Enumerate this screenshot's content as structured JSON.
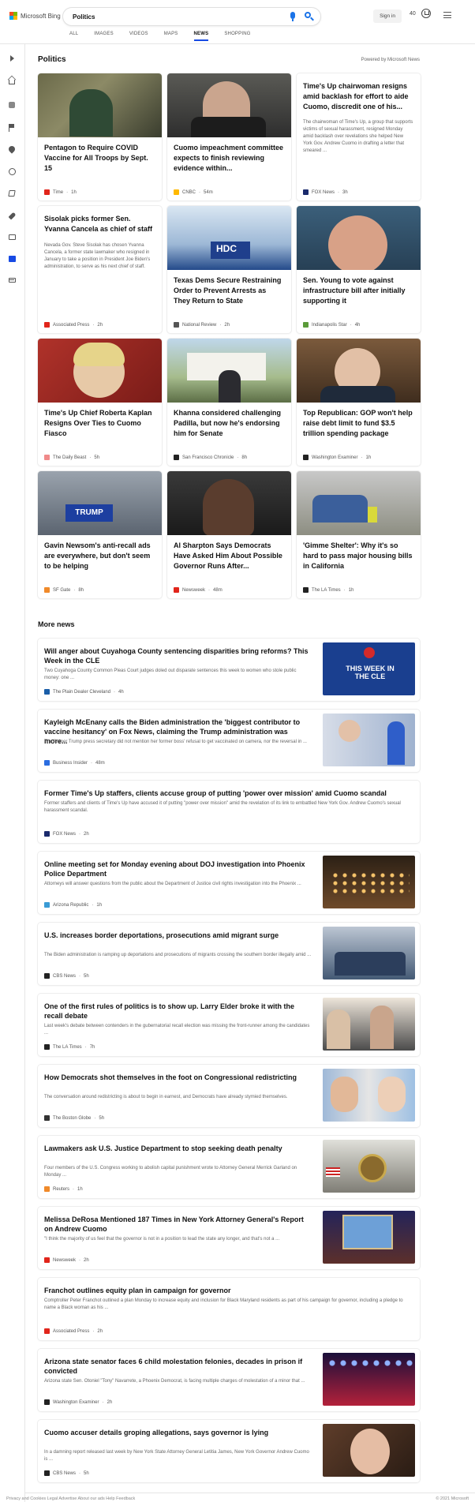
{
  "header": {
    "logo_text": "Microsoft Bing",
    "search_value": "Politics",
    "signin_label": "Sign in",
    "rewards_count": "40",
    "tabs": [
      {
        "label": "ALL",
        "active": false
      },
      {
        "label": "IMAGES",
        "active": false
      },
      {
        "label": "VIDEOS",
        "active": false
      },
      {
        "label": "MAPS",
        "active": false
      },
      {
        "label": "NEWS",
        "active": true
      },
      {
        "label": "SHOPPING",
        "active": false
      }
    ]
  },
  "main": {
    "title": "Politics",
    "powered_by": "Powered by Microsoft News",
    "top_stories": [
      {
        "title": "Pentagon to Require COVID Vaccine for All Troops by Sept. 15",
        "snippet": "",
        "source": "Time",
        "age": "1h",
        "logo_color": "#e1251b",
        "art": "a1"
      },
      {
        "title": "Cuomo impeachment committee expects to finish reviewing evidence within...",
        "snippet": "",
        "source": "CNBC",
        "age": "54m",
        "logo_color": "#ffb900",
        "art": "a2"
      },
      {
        "title": "Time's Up chairwoman resigns amid backlash for effort to aide Cuomo, discredit one of his...",
        "snippet": "The chairwoman of Time's Up, a group that supports victims of sexual harassment, resigned Monday amid backlash over revelations she helped New York Gov. Andrew Cuomo in drafting a letter that smeared ...",
        "source": "FOX News",
        "age": "3h",
        "logo_color": "#1a2a6c",
        "art": ""
      },
      {
        "title": "Sisolak picks former Sen. Yvanna Cancela as chief of staff",
        "snippet": "Nevada Gov. Steve Sisolak has chosen Yvanna Cancela, a former state lawmaker who resigned in January to take a position in President Joe Biden's administration, to serve as his next chief of staff.",
        "source": "Associated Press",
        "age": "2h",
        "logo_color": "#e1251b",
        "art": ""
      },
      {
        "title": "Texas Dems Secure Restraining Order to Prevent Arrests as They Return to State",
        "snippet": "",
        "source": "National Review",
        "age": "2h",
        "logo_color": "#555555",
        "art": "a3"
      },
      {
        "title": "Sen. Young to vote against infrastructure bill after initially supporting it",
        "snippet": "",
        "source": "Indianapolis Star",
        "age": "4h",
        "logo_color": "#5b9b3a",
        "art": "a4"
      },
      {
        "title": "Time's Up Chief Roberta Kaplan Resigns Over Ties to Cuomo Fiasco",
        "snippet": "",
        "source": "The Daily Beast",
        "age": "5h",
        "logo_color": "#f08a8a",
        "art": "a5"
      },
      {
        "title": "Khanna considered challenging Padilla, but now he's endorsing him for Senate",
        "snippet": "",
        "source": "San Francisco Chronicle",
        "age": "8h",
        "logo_color": "#222222",
        "art": "a6"
      },
      {
        "title": "Top Republican: GOP won't help raise debt limit to fund $3.5 trillion spending package",
        "snippet": "",
        "source": "Washington Examiner",
        "age": "1h",
        "logo_color": "#222222",
        "art": "a7"
      },
      {
        "title": "Gavin Newsom's anti-recall ads are everywhere, but don't seem to be helping",
        "snippet": "",
        "source": "SF Gate",
        "age": "8h",
        "logo_color": "#f08a2a",
        "art": "a8"
      },
      {
        "title": "Al Sharpton Says Democrats Have Asked Him About Possible Governor Runs After...",
        "snippet": "",
        "source": "Newsweek",
        "age": "48m",
        "logo_color": "#e1251b",
        "art": "a9"
      },
      {
        "title": "'Gimme Shelter': Why it's so hard to pass major housing bills in California",
        "snippet": "",
        "source": "The LA Times",
        "age": "1h",
        "logo_color": "#222222",
        "art": "a10"
      }
    ],
    "more_title": "More news",
    "more_news": [
      {
        "title": "Will anger about Cuyahoga County sentencing disparities bring reforms? This Week in the CLE",
        "snippet": "Two Cuyahoga County Common Pleas Court judges doled out disparate sentences this week to women who stole public money: one ...",
        "source": "The Plain Dealer Cleveland",
        "age": "4h",
        "logo_color": "#1a5ea8",
        "art": "r1"
      },
      {
        "title": "Kayleigh McEnany calls the Biden administration the 'biggest contributor to vaccine hesitancy' on Fox News, claiming the Trump administration was more...",
        "snippet": "The former Trump press secretary did not mention her former boss' refusal to get vaccinated on camera, nor the reversal in ...",
        "source": "Business Insider",
        "age": "48m",
        "logo_color": "#2b6de0",
        "art": "r2"
      },
      {
        "title": "Former Time's Up staffers, clients accuse group of putting 'power over mission' amid Cuomo scandal",
        "snippet": "Former staffers and clients of Time's Up have accused it of putting \"power over mission\" amid the revelation of its link to embattled New York Gov. Andrew Cuomo's sexual harassment scandal.",
        "source": "FOX News",
        "age": "2h",
        "logo_color": "#1a2a6c",
        "art": ""
      },
      {
        "title": "Online meeting set for Monday evening about DOJ investigation into Phoenix Police Department",
        "snippet": "Attorneys will answer questions from the public about the Department of Justice civil rights investigation into the Phoenix ...",
        "source": "Arizona Republic",
        "age": "1h",
        "logo_color": "#3a9bd5",
        "art": "r3"
      },
      {
        "title": "U.S. increases border deportations, prosecutions amid migrant surge",
        "snippet": "The Biden administration is ramping up deportations and prosecutions of migrants crossing the southern border illegally amid ...",
        "source": "CBS News",
        "age": "5h",
        "logo_color": "#222222",
        "art": "r4"
      },
      {
        "title": "One of the first rules of politics is to show up. Larry Elder broke it with the recall debate",
        "snippet": "Last week's debate between contenders in the gubernatorial recall election was missing the front-runner among the candidates ...",
        "source": "The LA Times",
        "age": "7h",
        "logo_color": "#222222",
        "art": "r5"
      },
      {
        "title": "How Democrats shot themselves in the foot on Congressional redistricting",
        "snippet": "The conversation around redistricting is about to begin in earnest, and Democrats have already stymied themselves.",
        "source": "The Boston Globe",
        "age": "5h",
        "logo_color": "#333333",
        "art": "r6"
      },
      {
        "title": "Lawmakers ask U.S. Justice Department to stop seeking death penalty",
        "snippet": "Four members of the U.S. Congress working to abolish capital punishment wrote to Attorney General Merrick Garland on Monday ...",
        "source": "Reuters",
        "age": "1h",
        "logo_color": "#f08a2a",
        "art": "r7"
      },
      {
        "title": "Melissa DeRosa Mentioned 187 Times in New York Attorney General's Report on Andrew Cuomo",
        "snippet": "\"I think the majority of us feel that the governor is not in a position to lead the state any longer, and that's not a ...",
        "source": "Newsweek",
        "age": "2h",
        "logo_color": "#e1251b",
        "art": "r8"
      },
      {
        "title": "Franchot outlines equity plan in campaign for governor",
        "snippet": "Comptroller Peter Franchot outlined a plan Monday to increase equity and inclusion for Black Maryland residents as part of his campaign for governor, including a pledge to name a Black woman as his ...",
        "source": "Associated Press",
        "age": "2h",
        "logo_color": "#e1251b",
        "art": ""
      },
      {
        "title": "Arizona state senator faces 6 child molestation felonies, decades in prison if convicted",
        "snippet": "Arizona state Sen. Otoniel \"Tony\" Navarrete, a Phoenix Democrat, is facing multiple charges of molestation of a minor that ...",
        "source": "Washington Examiner",
        "age": "2h",
        "logo_color": "#222222",
        "art": "r9"
      },
      {
        "title": "Cuomo accuser details groping allegations, says governor is lying",
        "snippet": "In a damning report released last week by New York State Attorney General Letitia James, New York Governor Andrew Cuomo is ...",
        "source": "CBS News",
        "age": "5h",
        "logo_color": "#222222",
        "art": "r10"
      }
    ]
  },
  "footer": {
    "left": "Privacy and Cookies  Legal  Advertise  About our ads  Help  Feedback",
    "right": "© 2021 Microsoft"
  }
}
